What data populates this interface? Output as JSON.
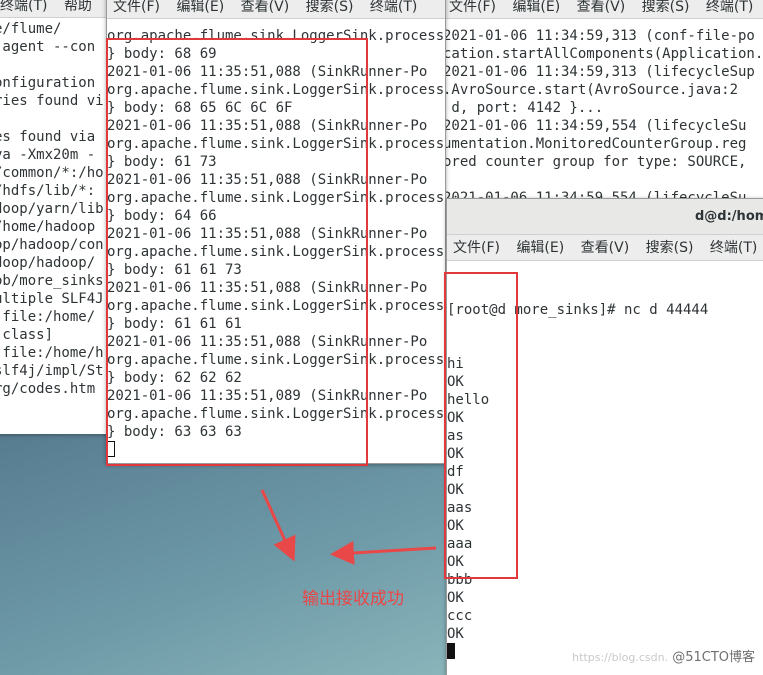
{
  "menus": {
    "left": [
      "终端(T)",
      "帮助"
    ],
    "terminal": [
      "文件(F)",
      "编辑(E)",
      "查看(V)",
      "搜索(S)",
      "终端(T)"
    ]
  },
  "left_window": {
    "lines": [
      "e/flume/",
      " agent --con",
      "",
      "onfiguration",
      "ries found vi",
      "",
      "es found via",
      "va -Xmx20m -",
      "/common/*:/ho",
      "/hdfs/lib/*:",
      "doop/yarn/lib",
      "/home/hadoop",
      "op/hadoop/con",
      "doop/hadoop/",
      "ob/more_sinks",
      "ultiple SLF4J",
      " file:/home/",
      " class]",
      " file:/home/h",
      "slf4j/impl/St",
      "rg/codes.htm"
    ]
  },
  "middle_window": {
    "lines": [
      "org.apache.flume.sink.LoggerSink.process",
      "} body: 68 69",
      "2021-01-06 11:35:51,088 (SinkRunner-Po",
      "org.apache.flume.sink.LoggerSink.process",
      "} body: 68 65 6C 6C 6F",
      "2021-01-06 11:35:51,088 (SinkRunner-Po",
      "org.apache.flume.sink.LoggerSink.process",
      "} body: 61 73",
      "2021-01-06 11:35:51,088 (SinkRunner-Po",
      "org.apache.flume.sink.LoggerSink.process",
      "} body: 64 66",
      "2021-01-06 11:35:51,088 (SinkRunner-Po",
      "org.apache.flume.sink.LoggerSink.process",
      "} body: 61 61 73",
      "2021-01-06 11:35:51,088 (SinkRunner-Po",
      "org.apache.flume.sink.LoggerSink.process",
      "} body: 61 61 61",
      "2021-01-06 11:35:51,088 (SinkRunner-Po",
      "org.apache.flume.sink.LoggerSink.process",
      "} body: 62 62 62",
      "2021-01-06 11:35:51,089 (SinkRunner-Po",
      "org.apache.flume.sink.LoggerSink.process",
      "} body: 63 63 63"
    ]
  },
  "right_window": {
    "lines": [
      "2021-01-06 11:34:59,313 (conf-file-po",
      "cation.startAllComponents(Application.",
      "2021-01-06 11:34:59,313 (lifecycleSup",
      ".AvroSource.start(AvroSource.java:2",
      " d, port: 4142 }...",
      "2021-01-06 11:34:59,554 (lifecycleSu",
      "umentation.MonitoredCounterGroup.reg",
      "ored counter group for type: SOURCE,",
      "",
      "2021-01-06 11:34:59,554 (lifecycleSu"
    ]
  },
  "nc_window": {
    "title": "d@d:/hom",
    "prompt": "[root@d more_sinks]# nc d 44444",
    "lines": [
      "hi",
      "OK",
      "hello",
      "OK",
      "as",
      "OK",
      "df",
      "OK",
      "aas",
      "OK",
      "aaa",
      "OK",
      "bbb",
      "OK",
      "ccc",
      "OK"
    ]
  },
  "annotation": "输出接收成功",
  "watermark": {
    "faint": "https://blog.csdn.",
    "text": "@51CTO博客"
  },
  "colors": {
    "highlight": "#e0383b",
    "annotation": "#ec4646"
  }
}
